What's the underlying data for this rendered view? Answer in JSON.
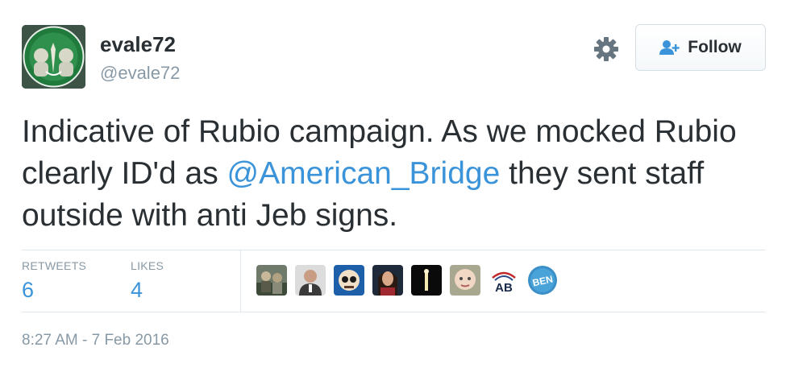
{
  "user": {
    "display_name": "evale72",
    "handle": "@evale72"
  },
  "follow_button": {
    "label": "Follow"
  },
  "tweet": {
    "text_before": "Indicative of Rubio campaign. As we mocked Rubio clearly ID'd as ",
    "mention": "@American_Bridge",
    "text_after": " they sent staff outside with anti Jeb signs."
  },
  "stats": {
    "retweets_label": "RETWEETS",
    "retweets_count": "6",
    "likes_label": "LIKES",
    "likes_count": "4"
  },
  "likers": {
    "ab_logo_text": "AB",
    "ben_logo_text": "BEN"
  },
  "timestamp": "8:27 AM - 7 Feb 2016",
  "colors": {
    "link": "#3b94d9",
    "muted": "#8899a6",
    "text": "#292f33"
  }
}
